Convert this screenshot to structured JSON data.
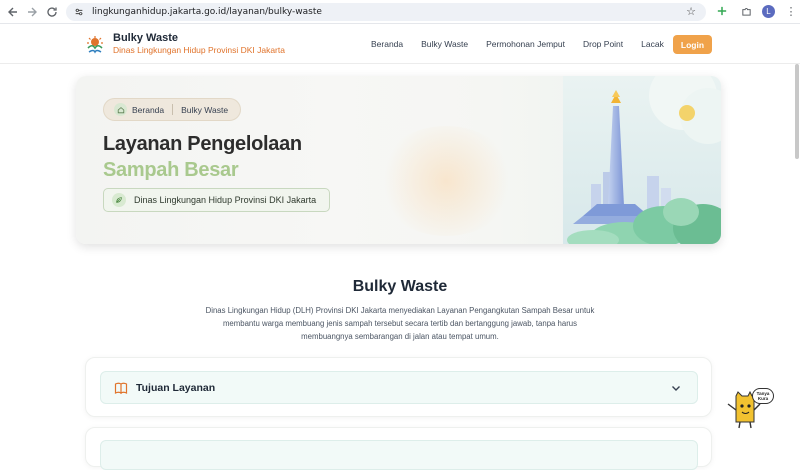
{
  "browser": {
    "url": "lingkunganhidup.jakarta.go.id/layanan/bulky-waste",
    "profile_initial": "L"
  },
  "header": {
    "brand_title": "Bulky Waste",
    "brand_subtitle": "Dinas Lingkungan Hidup Provinsi DKI Jakarta",
    "nav": [
      "Beranda",
      "Bulky Waste",
      "Permohonan Jemput",
      "Drop Point",
      "Lacak"
    ],
    "login_label": "Login"
  },
  "hero": {
    "breadcrumb": [
      "Beranda",
      "Bulky Waste"
    ],
    "title_line1": "Layanan Pengelolaan",
    "title_line2": "Sampah Besar",
    "agency_label": "Dinas Lingkungan Hidup Provinsi DKI Jakarta"
  },
  "content": {
    "section_title": "Bulky Waste",
    "description": "Dinas Lingkungan Hidup (DLH) Provinsi DKI Jakarta menyediakan Layanan Pengangkutan Sampah Besar untuk membantu warga membuang jenis sampah tersebut secara tertib dan bertanggung jawab, tanpa harus membuangnya sembarangan di jalan atau tempat umum.",
    "accordion": [
      {
        "label": "Tujuan Layanan",
        "expanded": false
      }
    ]
  },
  "mascot": {
    "bubble_text": "Tanya Kura"
  },
  "colors": {
    "accent_orange": "#f0a24a",
    "brand_sub": "#e0732b",
    "title_green": "#a9c98e"
  }
}
